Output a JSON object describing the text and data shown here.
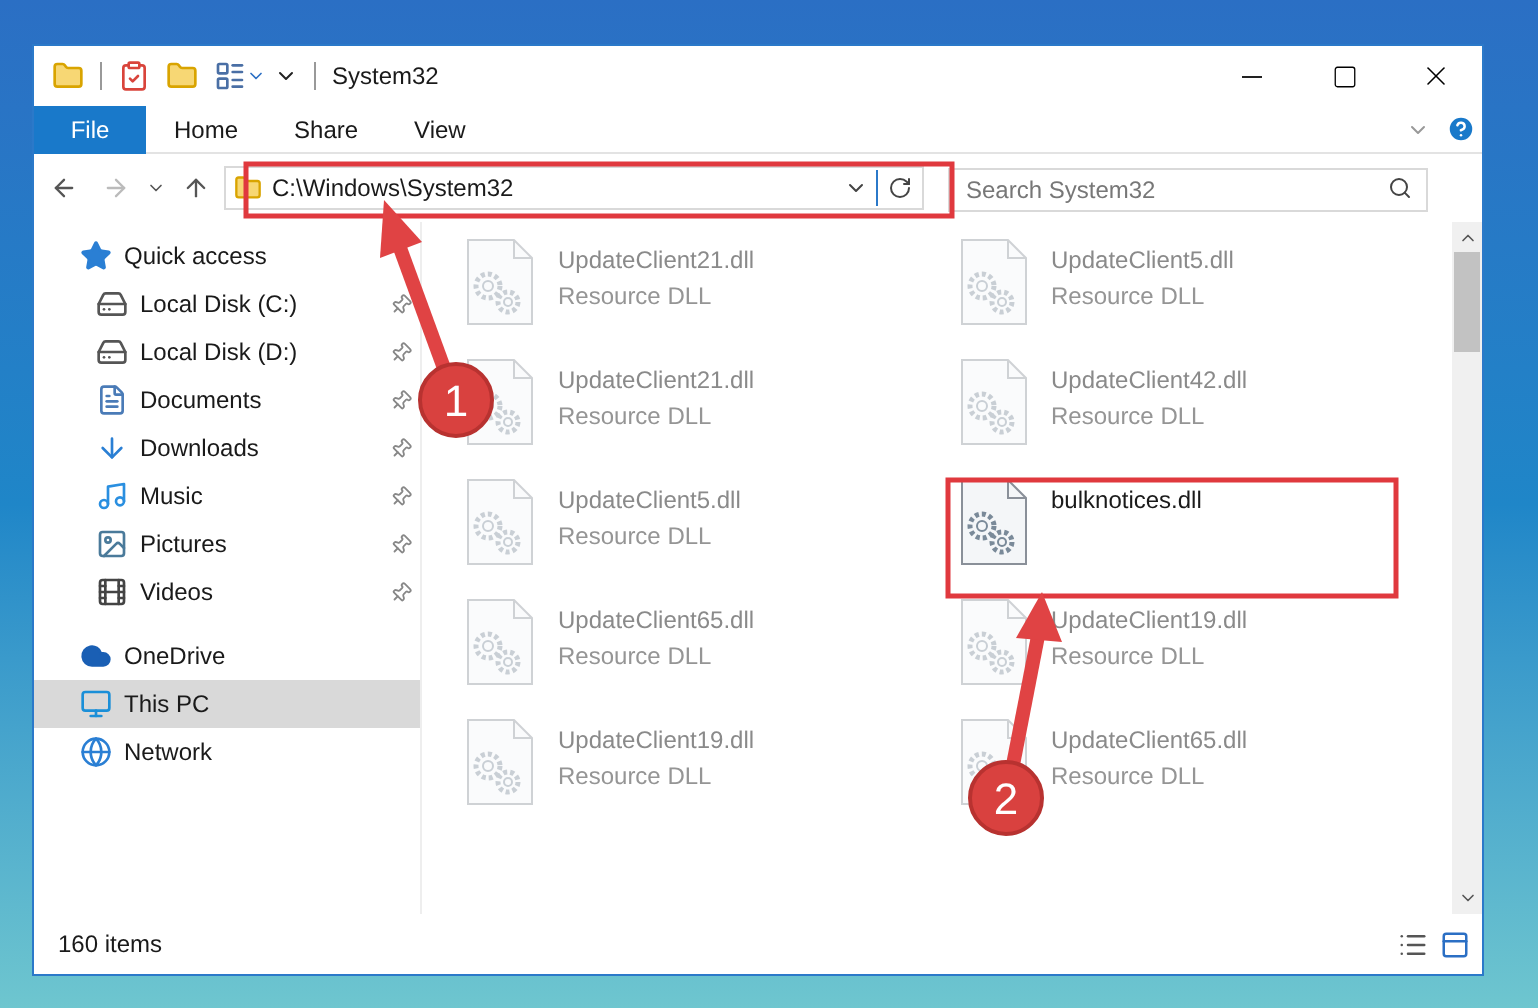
{
  "window": {
    "title": "System32"
  },
  "ribbon": {
    "tabs": [
      {
        "label": "File",
        "kind": "file"
      },
      {
        "label": "Home",
        "kind": "tab"
      },
      {
        "label": "Share",
        "kind": "tab"
      },
      {
        "label": "View",
        "kind": "tab"
      }
    ]
  },
  "address_bar": {
    "path": "C:\\Windows\\System32"
  },
  "search": {
    "placeholder": "Search System32"
  },
  "sidebar": {
    "items": [
      {
        "label": "Quick access",
        "selected": false,
        "children": [
          {
            "label": "Local Disk (C:)",
            "pinned": true
          },
          {
            "label": "Local Disk (D:)",
            "pinned": true
          },
          {
            "label": "Documents",
            "pinned": true
          },
          {
            "label": "Downloads",
            "pinned": true
          },
          {
            "label": "Music",
            "pinned": true
          },
          {
            "label": "Pictures",
            "pinned": true
          },
          {
            "label": "Videos",
            "pinned": true
          }
        ]
      },
      {
        "label": "OneDrive",
        "selected": false
      },
      {
        "label": "This PC",
        "selected": true
      },
      {
        "label": "Network",
        "selected": false
      }
    ]
  },
  "files": [
    {
      "name": "UpdateClient21.dll",
      "type": "Resource DLL",
      "blurred": true
    },
    {
      "name": "UpdateClient5.dll",
      "type": "Resource DLL",
      "blurred": true
    },
    {
      "name": "UpdateClient21.dll",
      "type": "Resource DLL",
      "blurred": true
    },
    {
      "name": "UpdateClient42.dll",
      "type": "Resource DLL",
      "blurred": true
    },
    {
      "name": "UpdateClient5.dll",
      "type": "Resource DLL",
      "blurred": true
    },
    {
      "name": "bulknotices.dll",
      "blurred": false
    },
    {
      "name": "UpdateClient65.dll",
      "type": "Resource DLL",
      "blurred": true
    },
    {
      "name": "UpdateClient19.dll",
      "type": "Resource DLL",
      "blurred": true
    },
    {
      "name": "UpdateClient19.dll",
      "type": "Resource DLL",
      "blurred": true
    },
    {
      "name": "UpdateClient65.dll",
      "type": "Resource DLL",
      "blurred": true
    }
  ],
  "annotations": [
    {
      "label": "1"
    },
    {
      "label": "2"
    }
  ],
  "status_bar": {
    "item_count": "160 items"
  }
}
